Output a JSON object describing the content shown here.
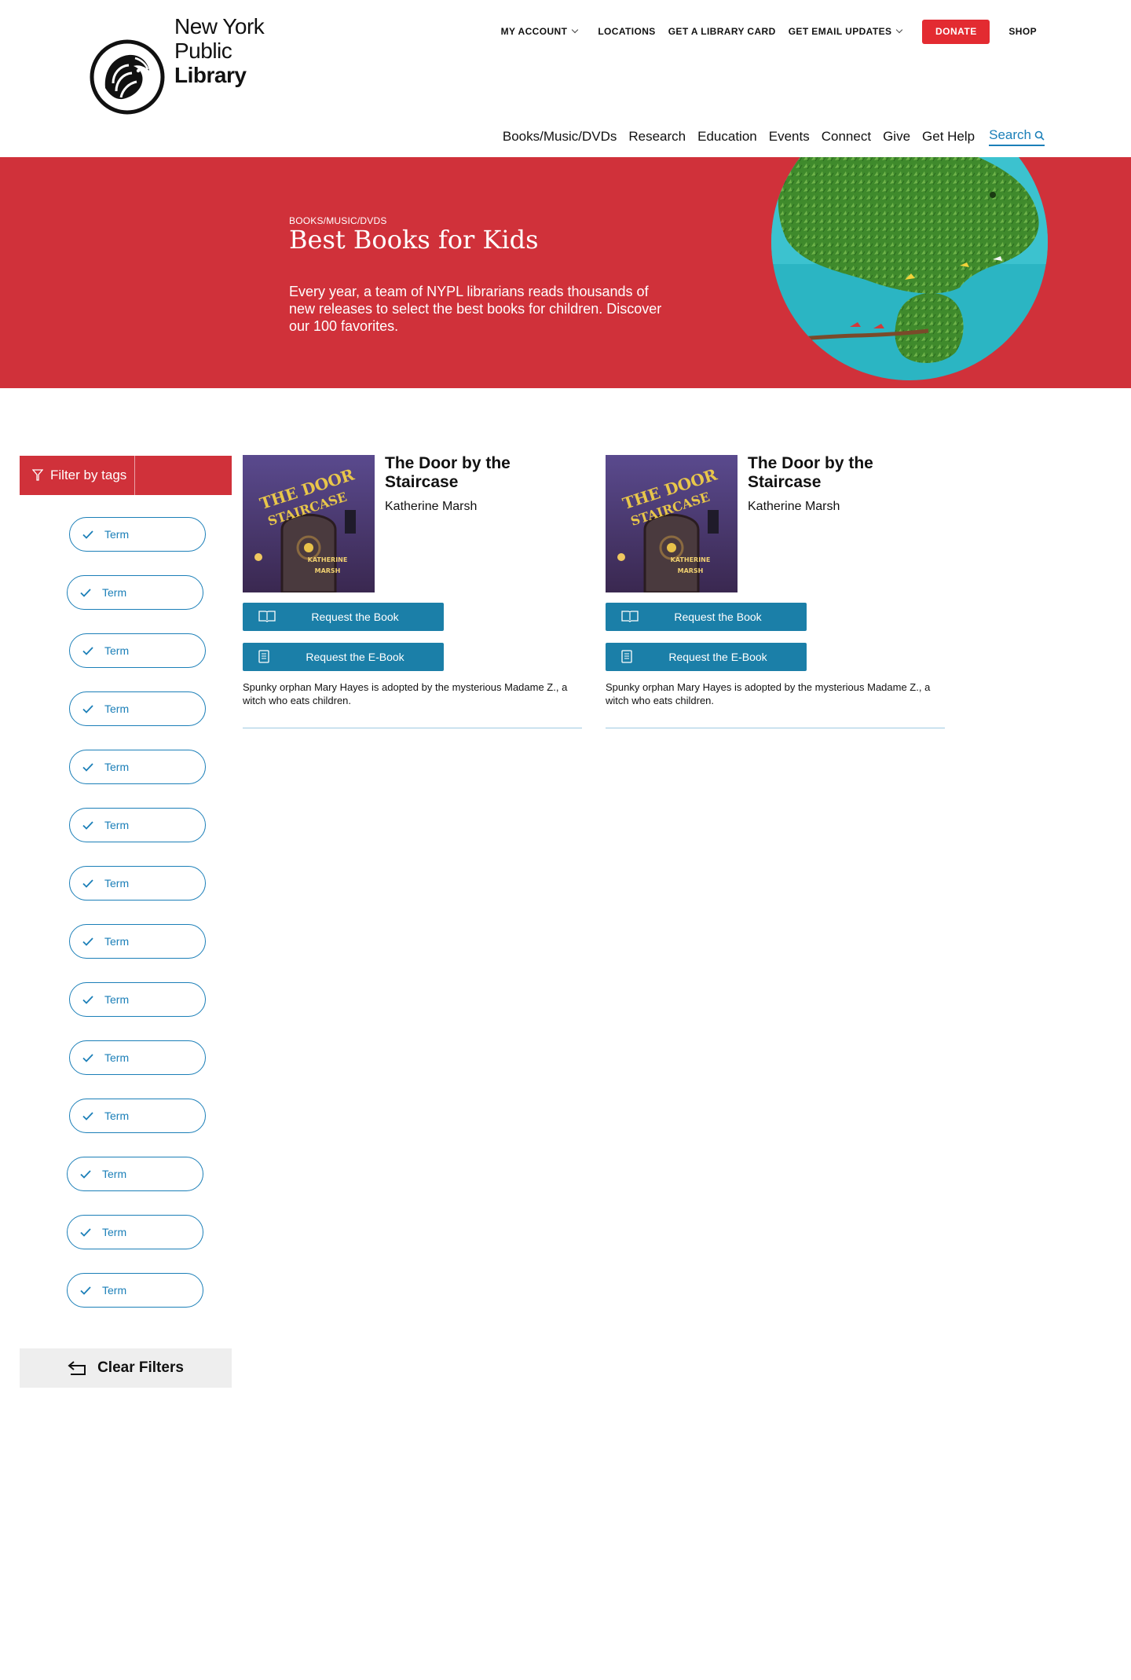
{
  "header": {
    "logo": {
      "line1": "New York",
      "line2": "Public",
      "line3": "Library"
    },
    "utility_nav": {
      "my_account": "MY ACCOUNT",
      "locations": "LOCATIONS",
      "library_card": "GET A LIBRARY CARD",
      "email_updates": "GET EMAIL UPDATES",
      "donate": "DONATE",
      "shop": "SHOP"
    },
    "main_nav": {
      "items": [
        "Books/Music/DVDs",
        "Research",
        "Education",
        "Events",
        "Connect",
        "Give",
        "Get Help"
      ],
      "search": "Search"
    }
  },
  "hero": {
    "breadcrumb": "BOOKS/MUSIC/DVDS",
    "title": "Best Books for Kids",
    "description": "Every year, a team of NYPL librarians reads thousands of new releases to select the best books for children. Discover our 100 favorites."
  },
  "sidebar": {
    "filter_label": "Filter by tags",
    "terms": [
      "Term",
      "Term",
      "Term",
      "Term",
      "Term",
      "Term",
      "Term",
      "Term",
      "Term",
      "Term",
      "Term",
      "Term",
      "Term",
      "Term"
    ],
    "clear_label": "Clear Filters"
  },
  "books": [
    {
      "title": "The Door by the Staircase",
      "author": "Katherine Marsh",
      "request_book": "Request the Book",
      "request_ebook": "Request the E-Book",
      "description": "Spunky orphan Mary Hayes is adopted by the mysterious Madame Z., a witch who eats children.",
      "cover_title": "THE DOOR BY THE STAIRCASE",
      "cover_author": "KATHERINE MARSH"
    },
    {
      "title": "The Door by the Staircase",
      "author": "Katherine Marsh",
      "request_book": "Request the Book",
      "request_ebook": "Request the E-Book",
      "description": "Spunky orphan Mary Hayes is adopted by the mysterious Madame Z., a witch who eats children.",
      "cover_title": "THE DOOR BY THE STAIRCASE",
      "cover_author": "KATHERINE MARSH"
    }
  ],
  "colors": {
    "brand_red": "#d0313a",
    "donate_red": "#e32b31",
    "link_blue": "#1b7fb8",
    "button_blue": "#1b7fa8"
  }
}
